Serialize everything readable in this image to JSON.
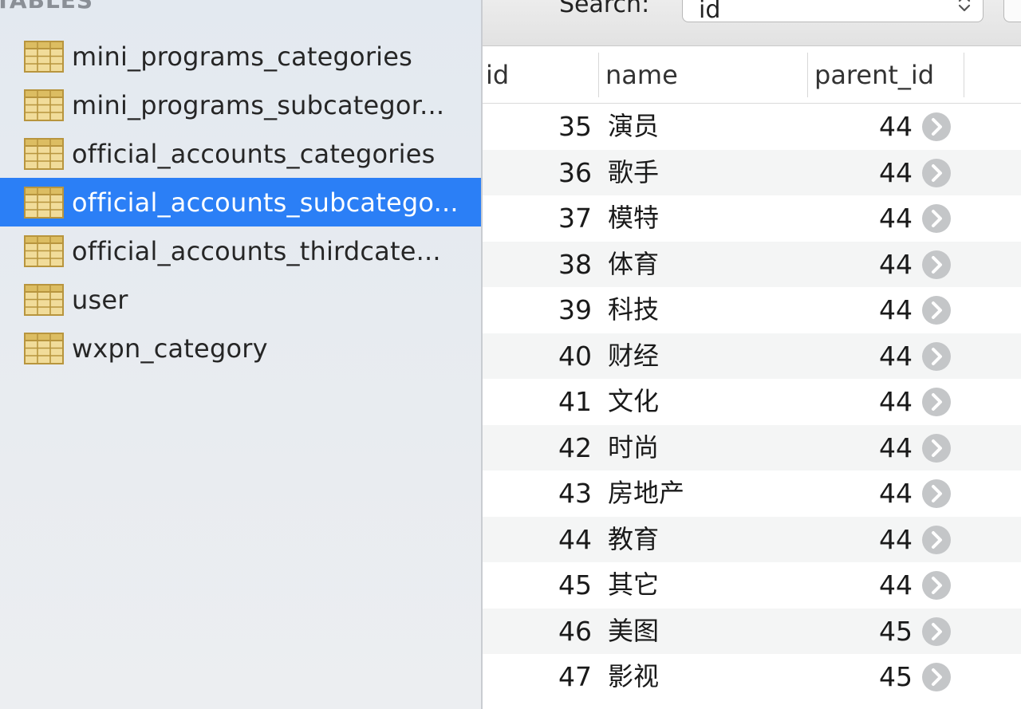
{
  "sidebar": {
    "header": "TABLES",
    "items": [
      {
        "label": "mini_programs_categories",
        "selected": false
      },
      {
        "label": "mini_programs_subcategor...",
        "selected": false
      },
      {
        "label": "official_accounts_categories",
        "selected": false
      },
      {
        "label": "official_accounts_subcatego...",
        "selected": true
      },
      {
        "label": "official_accounts_thirdcate...",
        "selected": false
      },
      {
        "label": "user",
        "selected": false
      },
      {
        "label": "wxpn_category",
        "selected": false
      }
    ],
    "icon": "table-icon",
    "selected_color": "#2b7ff6"
  },
  "toolbar": {
    "search_label": "Search:",
    "search_field_value": "id"
  },
  "grid": {
    "columns": [
      {
        "key": "id",
        "label": "id"
      },
      {
        "key": "name",
        "label": "name"
      },
      {
        "key": "parent_id",
        "label": "parent_id"
      }
    ],
    "rows": [
      {
        "id": "35",
        "name": "演员",
        "parent_id": "44"
      },
      {
        "id": "36",
        "name": "歌手",
        "parent_id": "44"
      },
      {
        "id": "37",
        "name": "模特",
        "parent_id": "44"
      },
      {
        "id": "38",
        "name": "体育",
        "parent_id": "44"
      },
      {
        "id": "39",
        "name": "科技",
        "parent_id": "44"
      },
      {
        "id": "40",
        "name": "财经",
        "parent_id": "44"
      },
      {
        "id": "41",
        "name": "文化",
        "parent_id": "44"
      },
      {
        "id": "42",
        "name": "时尚",
        "parent_id": "44"
      },
      {
        "id": "43",
        "name": "房地产",
        "parent_id": "44"
      },
      {
        "id": "44",
        "name": "教育",
        "parent_id": "44"
      },
      {
        "id": "45",
        "name": "其它",
        "parent_id": "44"
      },
      {
        "id": "46",
        "name": "美图",
        "parent_id": "45"
      },
      {
        "id": "47",
        "name": "影视",
        "parent_id": "45"
      }
    ],
    "fk_icon": "arrow-right-circle-icon"
  }
}
